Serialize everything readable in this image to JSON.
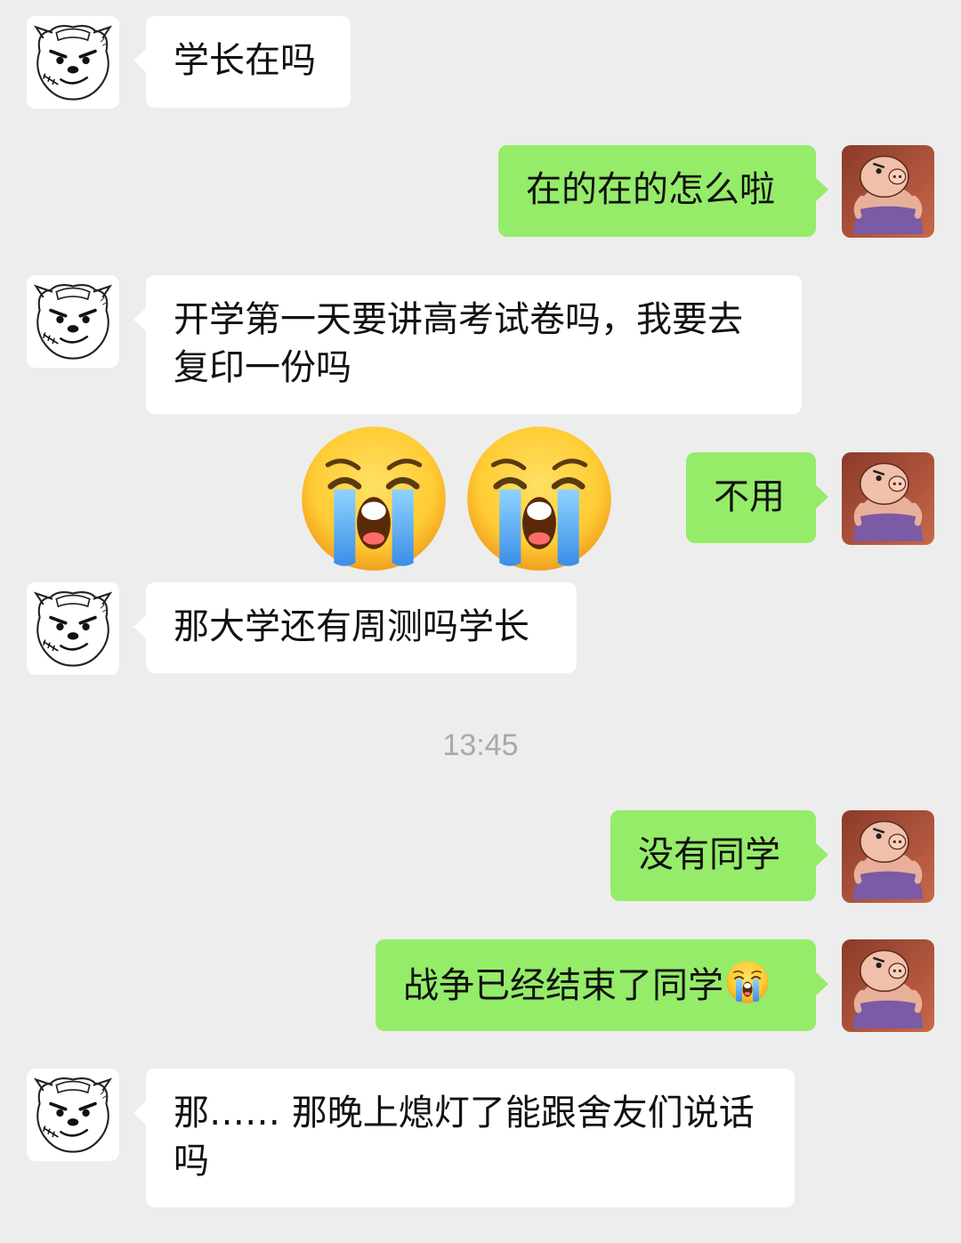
{
  "chat": {
    "messages": [
      {
        "side": "in",
        "text": "学长在吗"
      },
      {
        "side": "out",
        "text": "在的在的怎么啦"
      },
      {
        "side": "in",
        "text": "开学第一天要讲高考试卷吗，我要去复印一份吗"
      },
      {
        "side": "out",
        "text": "不用",
        "emoji_before": [
          "loudly-crying-face-emoji",
          "loudly-crying-face-emoji"
        ]
      },
      {
        "side": "in",
        "text": "那大学还有周测吗学长"
      },
      {
        "side": "out",
        "text": "没有同学"
      },
      {
        "side": "out",
        "text": "战争已经结束了同学",
        "emoji_after": "loudly-crying-face-emoji"
      },
      {
        "side": "in",
        "text": "那…… 那晚上熄灯了能跟舍友们说话吗"
      }
    ],
    "timestamp": "13:45",
    "avatars": {
      "left": "angry-cartoon-bear-avatar",
      "right": "cartoon-character-pink-avatar"
    }
  },
  "colors": {
    "background": "#ededed",
    "incoming_bubble": "#ffffff",
    "outgoing_bubble": "#95ec69",
    "timestamp_text": "#a9a9a9"
  }
}
